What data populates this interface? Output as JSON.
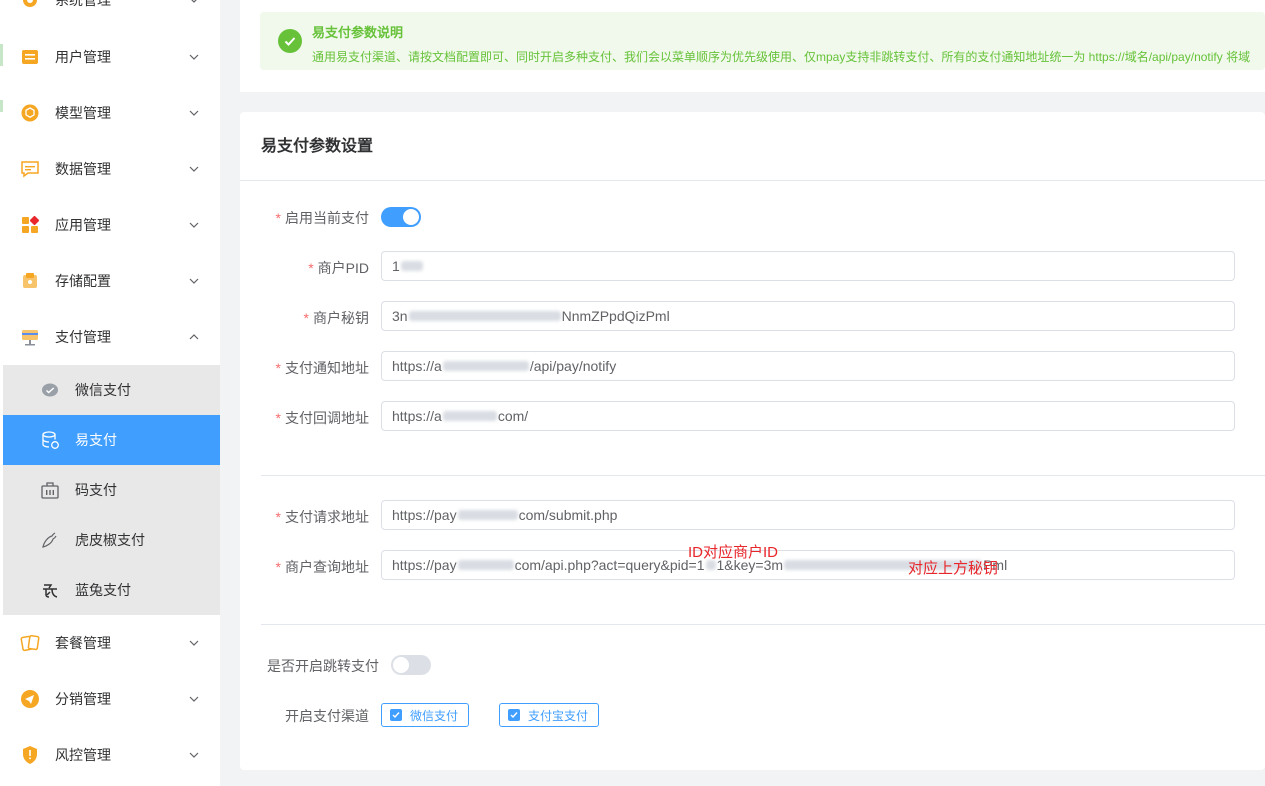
{
  "sidebar": {
    "items": [
      {
        "label": "系统管理",
        "icon": "gear-icon"
      },
      {
        "label": "用户管理",
        "icon": "user-card-icon"
      },
      {
        "label": "模型管理",
        "icon": "model-cube-icon"
      },
      {
        "label": "数据管理",
        "icon": "chat-data-icon"
      },
      {
        "label": "应用管理",
        "icon": "apps-grid-icon"
      },
      {
        "label": "存储配置",
        "icon": "storage-box-icon"
      },
      {
        "label": "支付管理",
        "icon": "payment-icon"
      },
      {
        "label": "套餐管理",
        "icon": "package-cards-icon"
      },
      {
        "label": "分销管理",
        "icon": "share-send-icon"
      },
      {
        "label": "风控管理",
        "icon": "shield-icon"
      }
    ],
    "sub_items": [
      {
        "label": "微信支付",
        "icon": "wechat-icon"
      },
      {
        "label": "易支付",
        "icon": "database-icon"
      },
      {
        "label": "码支付",
        "icon": "cash-register-icon"
      },
      {
        "label": "虎皮椒支付",
        "icon": "pepper-icon"
      },
      {
        "label": "蓝兔支付",
        "icon": "rabbit-icon"
      }
    ],
    "active_sub": "易支付"
  },
  "notice": {
    "title": "易支付参数说明",
    "text": "通用易支付渠道、请按文档配置即可、同时开启多种支付、我们会以菜单顺序为优先级使用、仅mpay支持非跳转支付、所有的支付通知地址统一为 https://域名/api/pay/notify 将域"
  },
  "card": {
    "title": "易支付参数设置",
    "fields": {
      "enable": {
        "label": "启用当前支付",
        "value": true
      },
      "pid": {
        "label": "商户PID",
        "prefix": "1",
        "suffix": ""
      },
      "secret": {
        "label": "商户秘钥",
        "prefix": "3n",
        "suffix": "NnmZPpdQizPml"
      },
      "notify_url": {
        "label": "支付通知地址",
        "prefix": "https://a",
        "suffix": "/api/pay/notify"
      },
      "return_url": {
        "label": "支付回调地址",
        "prefix": "https://a",
        "suffix": "com/"
      },
      "request_url": {
        "label": "支付请求地址",
        "prefix": "https://pay",
        "suffix": "com/submit.php"
      },
      "query_url": {
        "label": "商户查询地址",
        "prefix": "https://pay",
        "mid1": "com/api.php?act=query&pid=1",
        "mid2": "1&key=3m",
        "suffix": "Pml"
      },
      "redirect": {
        "label": "是否开启跳转支付",
        "value": false
      },
      "channels": {
        "label": "开启支付渠道",
        "options": [
          "微信支付",
          "支付宝支付"
        ]
      }
    },
    "annotations": {
      "id_note": "ID对应商户ID",
      "key_note": "对应上方秘钥"
    }
  },
  "colors": {
    "primary": "#409eff",
    "success": "#67c23a",
    "required": "#f56c6c",
    "annotation": "#e8262b"
  }
}
